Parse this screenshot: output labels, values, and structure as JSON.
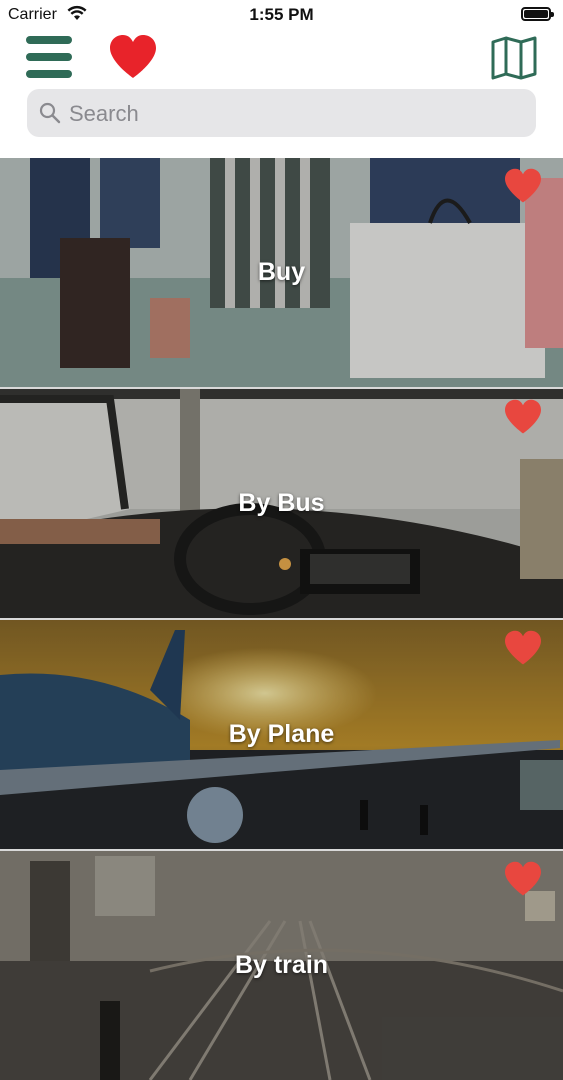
{
  "status": {
    "carrier": "Carrier",
    "time": "1:55 PM",
    "battery_level": 1.0
  },
  "header": {
    "menu_icon": "hamburger-menu-icon",
    "favorites_icon": "heart-icon",
    "map_icon": "map-icon",
    "accent_color": "#2f6b57",
    "heart_color": "#e8232a"
  },
  "search": {
    "placeholder": "Search",
    "value": ""
  },
  "categories": [
    {
      "title": "Buy",
      "favorited": true
    },
    {
      "title": "By Bus",
      "favorited": true
    },
    {
      "title": "By Plane",
      "favorited": true
    },
    {
      "title": "By train",
      "favorited": true
    }
  ]
}
